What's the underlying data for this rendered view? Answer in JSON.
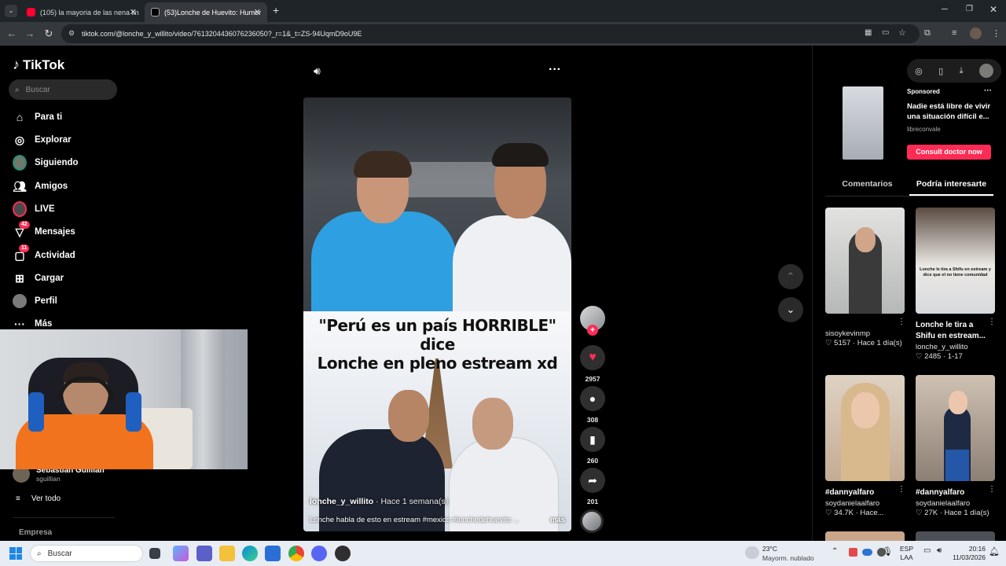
{
  "browser": {
    "tabs": [
      {
        "title": "(105) la mayoria de las nena lin",
        "color": "#ff0033"
      },
      {
        "title": "(53)Lonche de Huevito: Humor",
        "color": "#ffffff"
      }
    ],
    "url": "tiktok.com/@lonche_y_willito/video/7613204436076236050?_r=1&_t=ZS-94UqmD9oU9E"
  },
  "sidebar": {
    "logo": "TikTok",
    "search_placeholder": "Buscar",
    "items": [
      {
        "label": "Para ti",
        "icon": "home-icon"
      },
      {
        "label": "Explorar",
        "icon": "compass-icon"
      },
      {
        "label": "Siguiendo",
        "icon": "following-avatar-icon"
      },
      {
        "label": "Amigos",
        "icon": "friends-icon"
      },
      {
        "label": "LIVE",
        "icon": "live-icon"
      },
      {
        "label": "Mensajes",
        "icon": "messages-icon",
        "badge": "42"
      },
      {
        "label": "Actividad",
        "icon": "activity-icon",
        "badge": "11"
      },
      {
        "label": "Cargar",
        "icon": "upload-icon"
      },
      {
        "label": "Perfil",
        "icon": "profile-icon"
      },
      {
        "label": "Más",
        "icon": "more-icon"
      }
    ],
    "following_account": {
      "name": "Sebastián Guillian",
      "handle": "sguillian"
    },
    "see_all": "Ver todo",
    "footer": "Empresa"
  },
  "video": {
    "caption_line1": "\"Perú es un país HORRIBLE\" dice",
    "caption_line2": "Lonche en pleno estream xd",
    "author": "lonche_y_willito",
    "time": "· Hace 1 semana(s)",
    "description": "Lonche habla de esto en estream #mexico #lonchedehuevito ...",
    "more": "más",
    "likes": "2957",
    "comments": "308",
    "saves": "260",
    "shares": "201"
  },
  "right_panel": {
    "ad": {
      "label": "Sponsored",
      "text": "Nadie está libre de vivir una situación difícil e...",
      "advertiser": "libreconvale",
      "cta": "Consult doctor now"
    },
    "tabs": [
      "Comentarios",
      "Podría interesarte"
    ],
    "cards": [
      {
        "title": "",
        "user": "sisoykevinmp",
        "meta": "♡ 5157 · Hace 1 día(s)",
        "overlay": ""
      },
      {
        "title": "Lonche le tira a Shifu en estream...",
        "user": "lonche_y_willito",
        "meta": "♡ 2485 · 1-17",
        "overlay": "Lonche le tira a Shifu en estream y dice que el no tiene comunidad"
      },
      {
        "title": "#dannyalfaro",
        "user": "soydanielaalfaro",
        "meta": "♡ 34.7K · Hace...",
        "overlay": ""
      },
      {
        "title": "#dannyalfaro",
        "user": "soydanielaalfaro",
        "meta": "♡ 27K · Hace 1 día(s)",
        "overlay": ""
      }
    ]
  },
  "taskbar": {
    "search": "Buscar",
    "weather_temp": "23°C",
    "weather_desc": "Mayorm. nublado",
    "lang1": "ESP",
    "lang2": "LAA",
    "time": "20:16",
    "date": "11/03/2026"
  },
  "colors": {
    "accent": "#fe2c55",
    "background": "#000000"
  }
}
